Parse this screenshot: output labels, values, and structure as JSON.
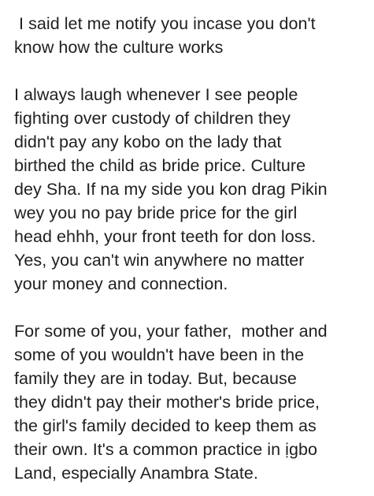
{
  "post": {
    "paragraphs": [
      {
        "lines": [
          " I said let me notify you incase you don't",
          "know how the culture works"
        ]
      },
      {
        "lines": [
          "I always laugh whenever I see people",
          "fighting over custody of children they",
          "didn't pay any kobo on the lady that",
          "birthed the child as bride price. Culture",
          "dey Sha. If na my side you kon drag Pikin",
          "wey you no pay bride price for the girl",
          "head ehhh, your front teeth for don loss.",
          "Yes, you can't win anywhere no matter",
          "your money and connection."
        ]
      },
      {
        "lines": [
          "For some of you, your father,  mother and",
          "some of you wouldn't have been in the",
          "family they are in today. But, because",
          "they didn't pay their mother's bride price,",
          "the girl's family decided to keep them as",
          "their own. It's a common practice in ịgbo",
          "Land, especially Anambra State."
        ]
      }
    ]
  }
}
